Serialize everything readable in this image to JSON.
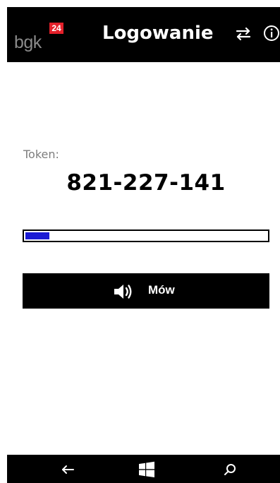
{
  "header": {
    "logo_text": "bgk",
    "logo_badge": "24",
    "title": "Logowanie",
    "icons": [
      "swap-icon",
      "info-icon"
    ]
  },
  "main": {
    "token_label": "Token:",
    "token_value": "821-227-141",
    "progress_fraction": 0.1,
    "speak_label": "Mów",
    "speak_icon": "speaker-icon"
  },
  "navbar": {
    "icons": [
      "back-arrow-icon",
      "windows-logo-icon",
      "search-icon"
    ]
  },
  "colors": {
    "header_bg": "#000000",
    "badge_red": "#e4202a",
    "progress_fill": "#1a1ad4"
  }
}
